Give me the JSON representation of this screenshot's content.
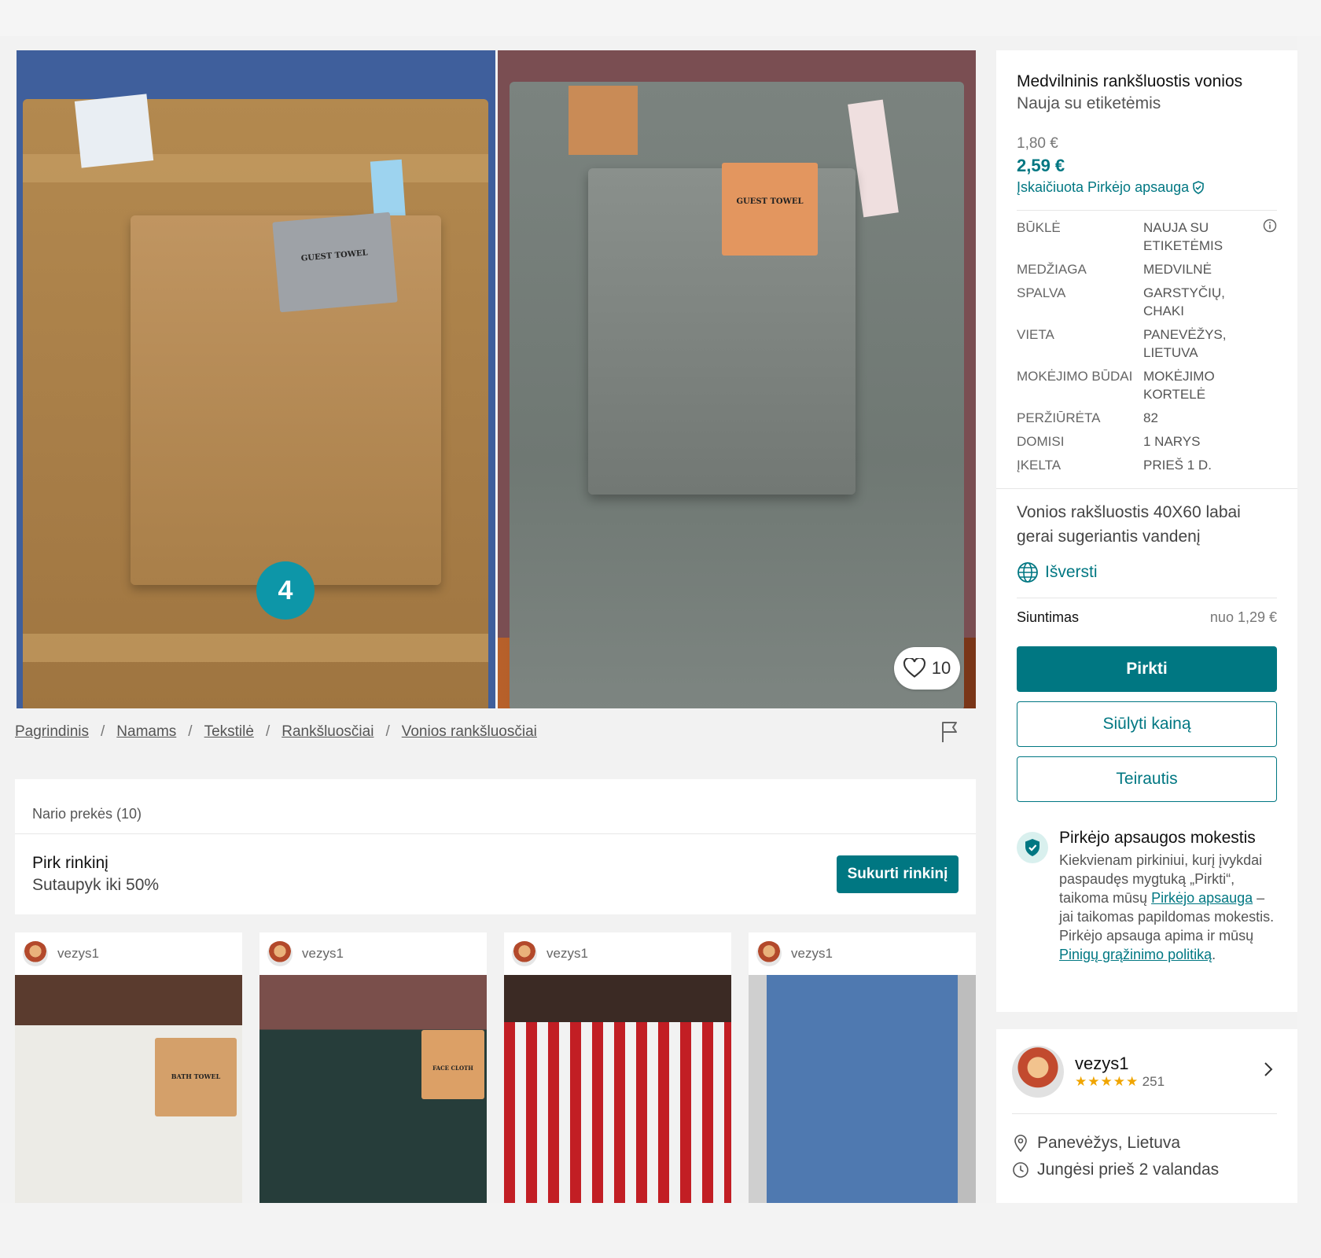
{
  "gallery": {
    "photo_count_badge": "4",
    "favorites_count": "10",
    "labels": [
      "GUEST TOWEL",
      "GUEST TOWEL"
    ]
  },
  "breadcrumb": [
    "Pagrindinis",
    "Namams",
    "Tekstilė",
    "Rankšluosčiai",
    "Vonios rankšluosčiai"
  ],
  "member_items": {
    "header": "Nario prekės (10)",
    "bundle_title": "Pirk rinkinį",
    "bundle_subtitle": "Sutaupyk iki 50%",
    "bundle_button": "Sukurti rinkinį",
    "cards": [
      {
        "user": "vezys1",
        "image": "white-towel-photo",
        "label": "BATH TOWEL"
      },
      {
        "user": "vezys1",
        "image": "dark-green-towel-photo",
        "label": "FACE CLOTH"
      },
      {
        "user": "vezys1",
        "image": "candy-ornaments-photo",
        "label": ""
      },
      {
        "user": "vezys1",
        "image": "denim-dress-photo",
        "label": ""
      }
    ]
  },
  "item": {
    "title": "Medvilninis rankšluostis vonios",
    "condition": "Nauja su etiketėmis",
    "price": "1,80 €",
    "price_with_protection": "2,59 €",
    "protection_note": "Įskaičiuota Pirkėjo apsauga",
    "details": [
      {
        "key": "Būklė",
        "value": "Nauja su etiketėmis"
      },
      {
        "key": "Medžiaga",
        "value": "Medvilnė"
      },
      {
        "key": "Spalva",
        "value": "Garstyčių, chaki"
      },
      {
        "key": "Vieta",
        "value": "Panevėžys, Lietuva"
      },
      {
        "key": "Mokėjimo būdai",
        "value": "Mokėjimo kortelė"
      },
      {
        "key": "Peržiūrėta",
        "value": "82"
      },
      {
        "key": "Domisi",
        "value": "1 narys"
      },
      {
        "key": "Įkelta",
        "value": "prieš 1 d."
      }
    ],
    "description": "Vonios rakšluostis 40X60 labai gerai sugeriantis vandenį",
    "translate_label": "Išversti",
    "shipping_label": "Siuntimas",
    "shipping_value": "nuo 1,29 €",
    "buy_button": "Pirkti",
    "offer_button": "Siūlyti kainą",
    "ask_button": "Teirautis",
    "fee_title": "Pirkėjo apsaugos mokestis",
    "fee_text_1": "Kiekvienam pirkiniui, kurį įvykdai paspaudęs mygtuką „Pirkti“, taikoma mūsų",
    "fee_link_1": "Pirkėjo apsauga",
    "fee_text_2": "– jai taikomas papildomas mokestis. Pirkėjo apsauga apima ir mūsų",
    "fee_link_2": "Pinigų grąžinimo politiką",
    "fee_text_3": "."
  },
  "seller": {
    "name": "vezys1",
    "stars": "★★★★★",
    "reviews": "251",
    "location": "Panevėžys, Lietuva",
    "last_seen": "Jungėsi prieš 2 valandas"
  },
  "colors": {
    "accent": "#007782",
    "badge": "#0d96a8",
    "star": "#f0a500"
  }
}
